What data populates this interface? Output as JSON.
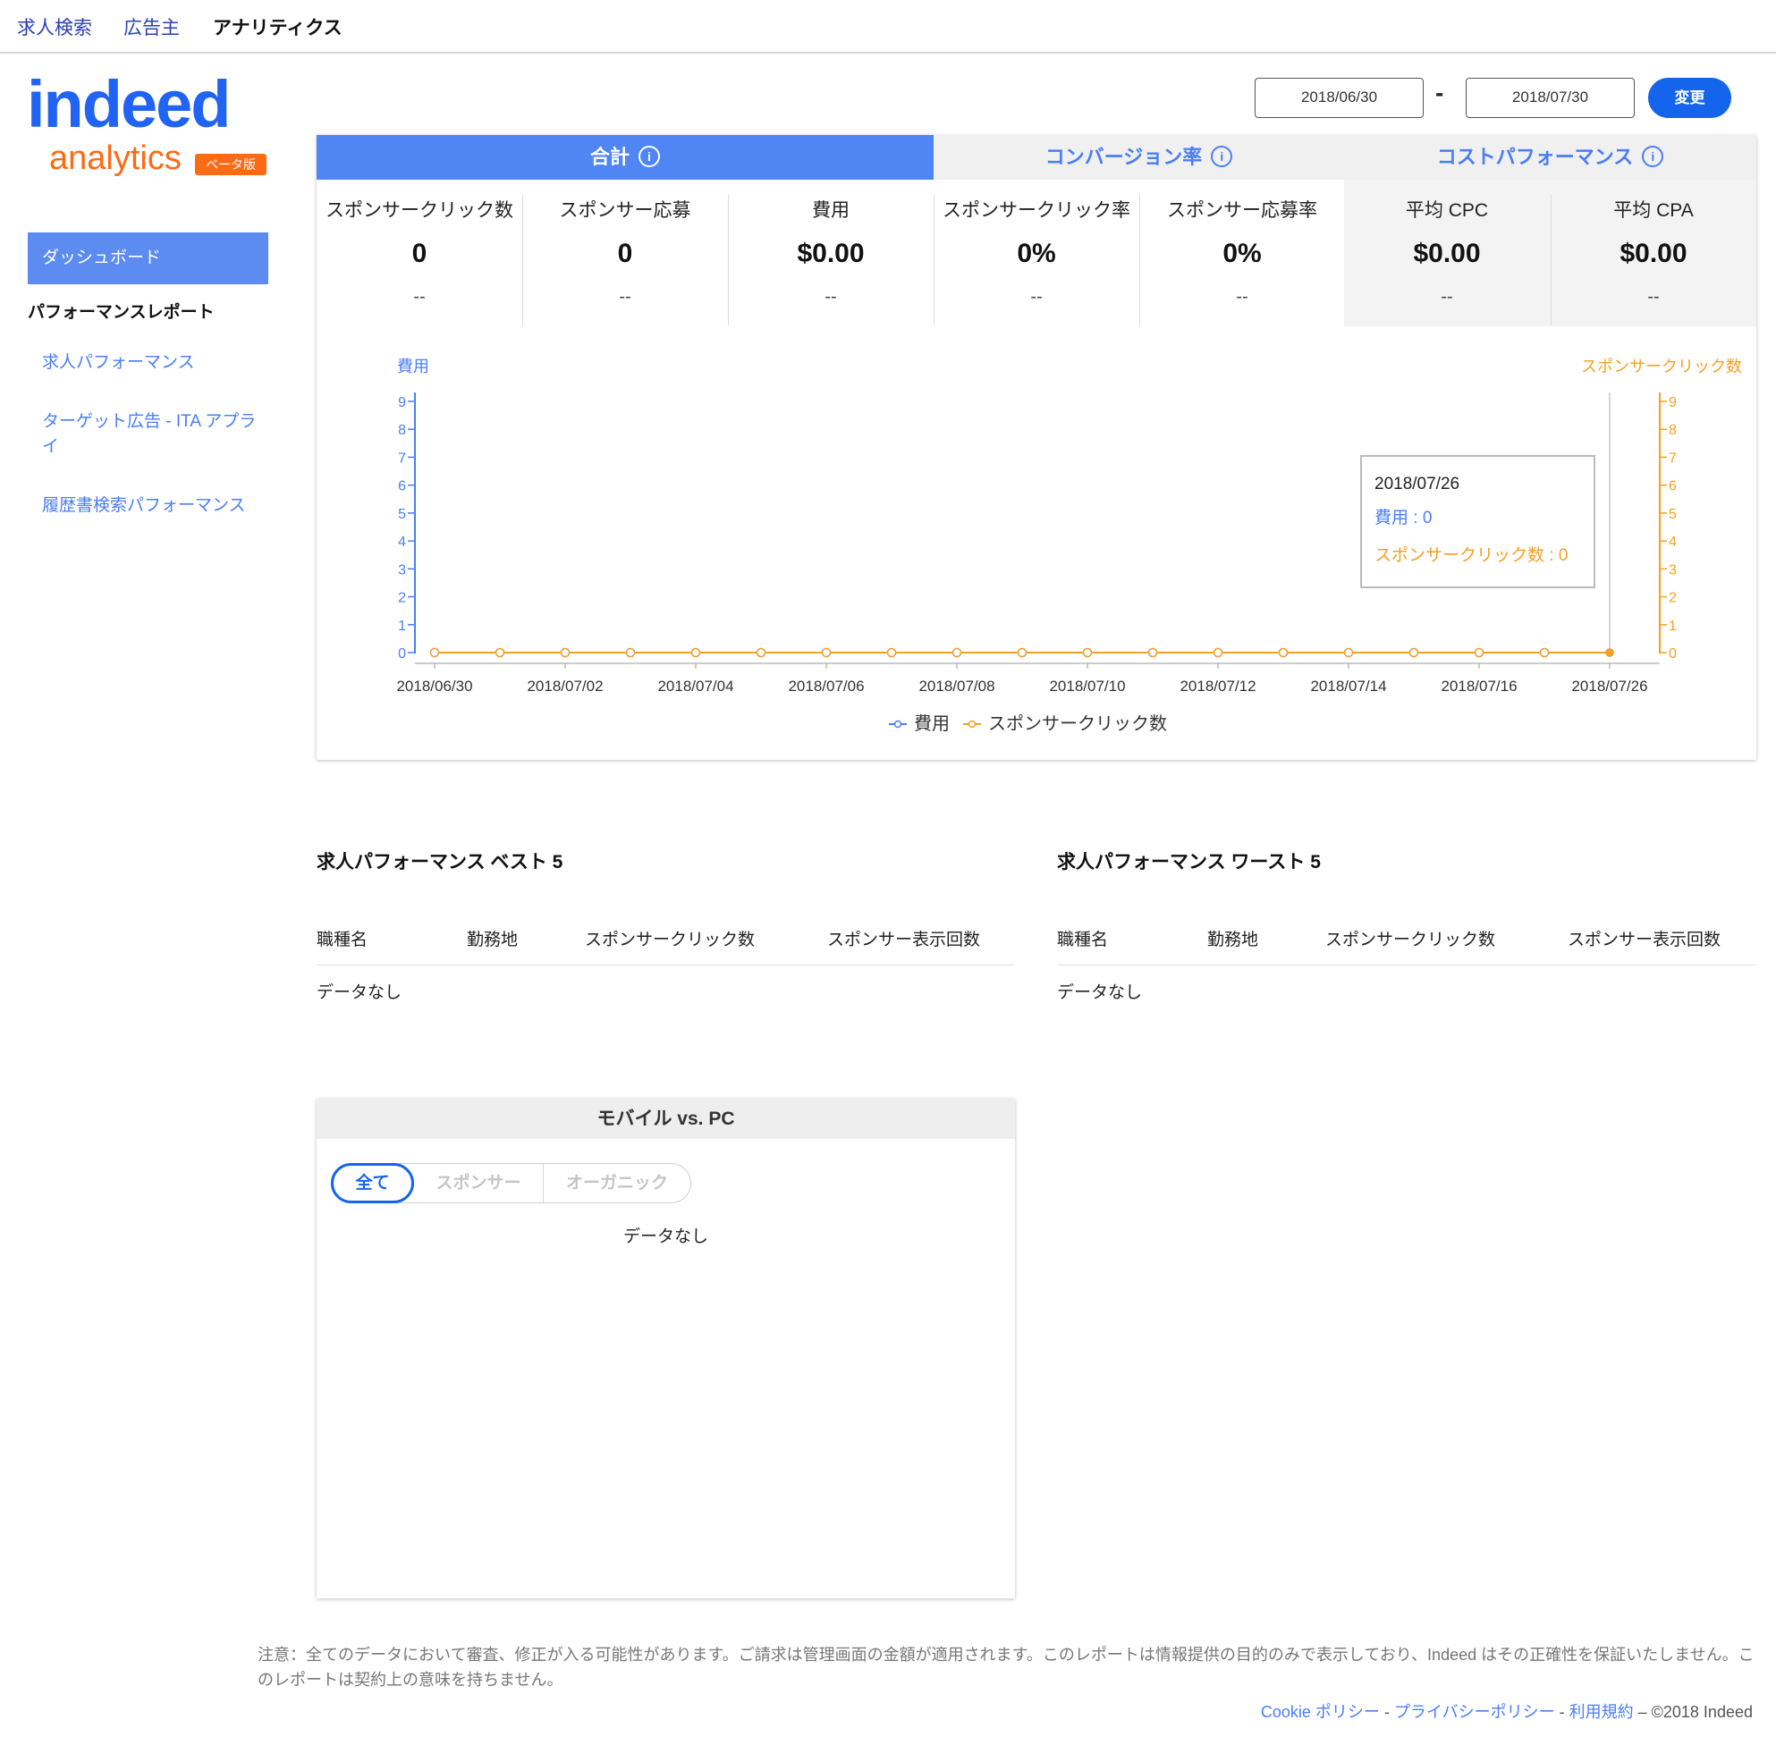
{
  "nav": {
    "items": [
      {
        "label": "求人検索"
      },
      {
        "label": "広告主"
      },
      {
        "label": "アナリティクス"
      }
    ]
  },
  "logo": {
    "brand": "indeed",
    "product": "analytics",
    "badge": "ベータ版",
    "brand_color": "#2164f3",
    "accent_color": "#ff6a14"
  },
  "sidebar": {
    "dashboard_label": "ダッシュボード",
    "section_label": "パフォーマンスレポート",
    "items": [
      {
        "label": "求人パフォーマンス"
      },
      {
        "label": "ターゲット広告 - ITA アプライ"
      },
      {
        "label": "履歴書検索パフォーマンス"
      }
    ]
  },
  "date_range": {
    "start": "2018/06/30",
    "separator": "-",
    "end": "2018/07/30",
    "change_label": "変更"
  },
  "tabs": [
    {
      "label": "合計",
      "icon": "info-icon",
      "active": true
    },
    {
      "label": "コンバージョン率",
      "icon": "info-icon",
      "active": false
    },
    {
      "label": "コストパフォーマンス",
      "icon": "info-icon",
      "active": false
    }
  ],
  "metrics": [
    {
      "label": "スポンサークリック数",
      "value": "0",
      "change": "--"
    },
    {
      "label": "スポンサー応募",
      "value": "0",
      "change": "--"
    },
    {
      "label": "費用",
      "value": "$0.00",
      "change": "--"
    },
    {
      "label": "スポンサークリック率",
      "value": "0%",
      "change": "--"
    },
    {
      "label": "スポンサー応募率",
      "value": "0%",
      "change": "--"
    },
    {
      "label": "平均 CPC",
      "value": "$0.00",
      "change": "--"
    },
    {
      "label": "平均 CPA",
      "value": "$0.00",
      "change": "--"
    }
  ],
  "chart_data": {
    "type": "line",
    "left_axis_label": "費用",
    "right_axis_label": "スポンサークリック数",
    "ylim": [
      0,
      9
    ],
    "y_ticks": [
      0,
      1,
      2,
      3,
      4,
      5,
      6,
      7,
      8,
      9
    ],
    "x": [
      "2018/06/30",
      "2018/07/01",
      "2018/07/02",
      "2018/07/03",
      "2018/07/04",
      "2018/07/05",
      "2018/07/06",
      "2018/07/07",
      "2018/07/08",
      "2018/07/09",
      "2018/07/10",
      "2018/07/11",
      "2018/07/12",
      "2018/07/13",
      "2018/07/14",
      "2018/07/15",
      "2018/07/16",
      "2018/07/17",
      "2018/07/26"
    ],
    "x_tick_labels": [
      "2018/06/30",
      "2018/07/02",
      "2018/07/04",
      "2018/07/06",
      "2018/07/08",
      "2018/07/10",
      "2018/07/12",
      "2018/07/14",
      "2018/07/16",
      "2018/07/26"
    ],
    "series": [
      {
        "name": "費用",
        "color": "#4a7ef5",
        "values": [
          0,
          0,
          0,
          0,
          0,
          0,
          0,
          0,
          0,
          0,
          0,
          0,
          0,
          0,
          0,
          0,
          0,
          0,
          0
        ]
      },
      {
        "name": "スポンサークリック数",
        "color": "#f5a022",
        "values": [
          0,
          0,
          0,
          0,
          0,
          0,
          0,
          0,
          0,
          0,
          0,
          0,
          0,
          0,
          0,
          0,
          0,
          0,
          0
        ]
      }
    ],
    "legend_position": "bottom",
    "tooltip": {
      "date": "2018/07/26",
      "line1": "費用 : 0",
      "line2": "スポンサークリック数 : 0"
    }
  },
  "best": {
    "title": "求人パフォーマンス ベスト 5",
    "headers": [
      "職種名",
      "勤務地",
      "スポンサークリック数",
      "スポンサー表示回数"
    ],
    "empty": "データなし"
  },
  "worst": {
    "title": "求人パフォーマンス ワースト 5",
    "headers": [
      "職種名",
      "勤務地",
      "スポンサークリック数",
      "スポンサー表示回数"
    ],
    "empty": "データなし"
  },
  "mobile_pc": {
    "title": "モバイル vs. PC",
    "segments": [
      "全て",
      "スポンサー",
      "オーガニック"
    ],
    "empty": "データなし"
  },
  "footer": {
    "note": "注意：全てのデータにおいて審査、修正が入る可能性があります。ご請求は管理画面の金額が適用されます。このレポートは情報提供の目的のみで表示しており、Indeed はその正確性を保証いたしません。このレポートは契約上の意味を持ちません。",
    "links": [
      "Cookie ポリシー",
      "プライバシーポリシー",
      "利用規約"
    ],
    "copyright": "©2018 Indeed"
  }
}
